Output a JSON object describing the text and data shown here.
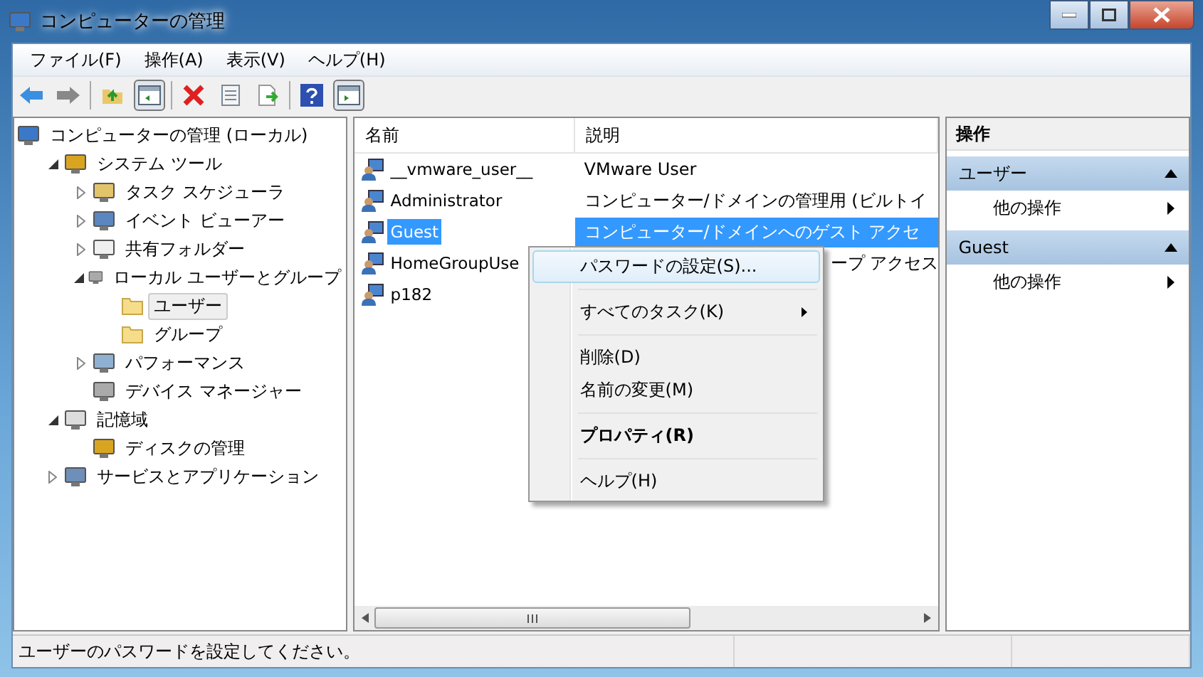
{
  "window": {
    "title": "コンピューターの管理"
  },
  "menu": [
    "ファイル(F)",
    "操作(A)",
    "表示(V)",
    "ヘルプ(H)"
  ],
  "tree": [
    {
      "label": "コンピューターの管理 (ローカル)",
      "kind": "root",
      "selected": false,
      "children": [
        {
          "label": "システム ツール",
          "kind": "node",
          "expanded": true,
          "selected": false,
          "children": [
            {
              "label": "タスク スケジューラ",
              "kind": "node",
              "expanded": false,
              "selected": false
            },
            {
              "label": "イベント ビューアー",
              "kind": "node",
              "expanded": false,
              "selected": false
            },
            {
              "label": "共有フォルダー",
              "kind": "node",
              "expanded": false,
              "selected": false
            },
            {
              "label": "ローカル ユーザーとグループ",
              "kind": "node",
              "expanded": true,
              "selected": false,
              "children": [
                {
                  "label": "ユーザー",
                  "kind": "leaf",
                  "selected": true
                },
                {
                  "label": "グループ",
                  "kind": "leaf",
                  "selected": false
                }
              ]
            },
            {
              "label": "パフォーマンス",
              "kind": "node",
              "expanded": false,
              "selected": false
            },
            {
              "label": "デバイス マネージャー",
              "kind": "leaf",
              "selected": false
            }
          ]
        },
        {
          "label": "記憶域",
          "kind": "node",
          "expanded": true,
          "selected": false,
          "children": [
            {
              "label": "ディスクの管理",
              "kind": "leaf",
              "selected": false
            }
          ]
        },
        {
          "label": "サービスとアプリケーション",
          "kind": "node",
          "expanded": false,
          "selected": false
        }
      ]
    }
  ],
  "list": {
    "columns": [
      "名前",
      "説明"
    ],
    "rows": [
      {
        "name": "__vmware_user__",
        "description": "VMware User",
        "selected": false
      },
      {
        "name": "Administrator",
        "description": "コンピューター/ドメインの管理用 (ビルトイ",
        "selected": false
      },
      {
        "name": "Guest",
        "description": "コンピューター/ドメインへのゲスト アクセ",
        "selected": true
      },
      {
        "name": "HomeGroupUse",
        "description": "ープ アクセス",
        "selected": false,
        "partly_hidden": true
      },
      {
        "name": "p182",
        "selected": false
      }
    ]
  },
  "context_menu": [
    {
      "kind": "item",
      "label": "パスワードの設定(S)...",
      "selected": true,
      "bold": false,
      "submenu": false
    },
    {
      "kind": "separator"
    },
    {
      "kind": "item",
      "label": "すべてのタスク(K)",
      "selected": false,
      "bold": false,
      "submenu": true
    },
    {
      "kind": "separator"
    },
    {
      "kind": "item",
      "label": "削除(D)",
      "selected": false,
      "bold": false,
      "submenu": false
    },
    {
      "kind": "item",
      "label": "名前の変更(M)",
      "selected": false,
      "bold": false,
      "submenu": false
    },
    {
      "kind": "separator"
    },
    {
      "kind": "item",
      "label": "プロパティ(R)",
      "selected": false,
      "bold": true,
      "submenu": false
    },
    {
      "kind": "separator"
    },
    {
      "kind": "item",
      "label": "ヘルプ(H)",
      "selected": false,
      "bold": false,
      "submenu": false
    }
  ],
  "actions": {
    "title": "操作",
    "sections": [
      {
        "title": "ユーザー",
        "expanded": true,
        "items": [
          "他の操作"
        ]
      },
      {
        "title": "Guest",
        "expanded": true,
        "items": [
          "他の操作"
        ]
      }
    ]
  },
  "status_bar": "ユーザーのパスワードを設定してください。"
}
